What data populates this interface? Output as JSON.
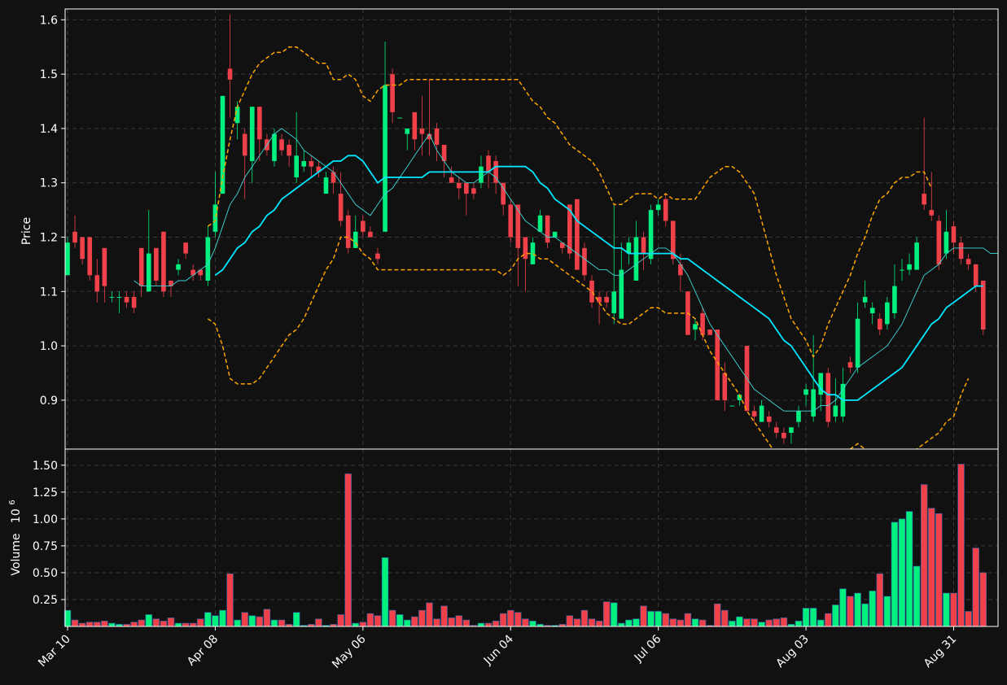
{
  "colors": {
    "background": "#111111",
    "up": "#00f080",
    "down": "#f0404a",
    "grid": "#3a3a3a",
    "axis": "#ffffff",
    "ma_fast": "#40d8d8",
    "ma_slow": "#00e8ff",
    "bollinger": "#ffa500"
  },
  "chart_data": {
    "type": "candlestick",
    "grid": true,
    "price_panel": {
      "ylabel": "Price",
      "ylim": [
        0.81,
        1.62
      ],
      "yticks": [
        "0.9",
        "1.0",
        "1.1",
        "1.2",
        "1.3",
        "1.4",
        "1.5",
        "1.6"
      ]
    },
    "volume_panel": {
      "ylabel": "Volume",
      "exponent_label": "10",
      "exponent_power": "6",
      "ylim": [
        0,
        1.65
      ],
      "yticks": [
        "0.25",
        "0.50",
        "0.75",
        "1.00",
        "1.25",
        "1.50"
      ]
    },
    "x_axis": {
      "index_range": [
        0,
        126
      ],
      "ticks": [
        {
          "label": "Mar 10",
          "index": 0
        },
        {
          "label": "Apr 08",
          "index": 20
        },
        {
          "label": "May 06",
          "index": 40
        },
        {
          "label": "Jun 04",
          "index": 60
        },
        {
          "label": "Jul 06",
          "index": 80
        },
        {
          "label": "Aug 03",
          "index": 100
        },
        {
          "label": "Aug 31",
          "index": 120
        }
      ]
    },
    "candles": [
      [
        1.13,
        1.19,
        1.2,
        1.13,
        0.15
      ],
      [
        1.21,
        1.19,
        1.24,
        1.18,
        0.06
      ],
      [
        1.2,
        1.16,
        1.2,
        1.15,
        0.03
      ],
      [
        1.2,
        1.13,
        1.2,
        1.12,
        0.04
      ],
      [
        1.13,
        1.1,
        1.16,
        1.08,
        0.04
      ],
      [
        1.18,
        1.11,
        1.18,
        1.08,
        0.05
      ],
      [
        1.09,
        1.09,
        1.1,
        1.08,
        0.03
      ],
      [
        1.09,
        1.09,
        1.1,
        1.06,
        0.02
      ],
      [
        1.09,
        1.08,
        1.1,
        1.07,
        0.02
      ],
      [
        1.09,
        1.07,
        1.1,
        1.06,
        0.04
      ],
      [
        1.18,
        1.11,
        1.18,
        1.09,
        0.06
      ],
      [
        1.1,
        1.17,
        1.25,
        1.1,
        0.11
      ],
      [
        1.18,
        1.12,
        1.18,
        1.11,
        0.07
      ],
      [
        1.21,
        1.1,
        1.21,
        1.09,
        0.05
      ],
      [
        1.12,
        1.11,
        1.12,
        1.09,
        0.08
      ],
      [
        1.14,
        1.15,
        1.16,
        1.13,
        0.03
      ],
      [
        1.19,
        1.17,
        1.19,
        1.16,
        0.03
      ],
      [
        1.14,
        1.13,
        1.15,
        1.12,
        0.03
      ],
      [
        1.14,
        1.13,
        1.14,
        1.12,
        0.07
      ],
      [
        1.12,
        1.2,
        1.22,
        1.11,
        0.13
      ],
      [
        1.21,
        1.26,
        1.32,
        1.2,
        0.1
      ],
      [
        1.28,
        1.46,
        1.46,
        1.28,
        0.15
      ],
      [
        1.51,
        1.49,
        1.61,
        1.42,
        0.49
      ],
      [
        1.41,
        1.44,
        1.45,
        1.38,
        0.06
      ],
      [
        1.39,
        1.35,
        1.4,
        1.27,
        0.13
      ],
      [
        1.34,
        1.44,
        1.44,
        1.3,
        0.1
      ],
      [
        1.44,
        1.38,
        1.44,
        1.34,
        0.09
      ],
      [
        1.38,
        1.36,
        1.39,
        1.35,
        0.16
      ],
      [
        1.34,
        1.39,
        1.4,
        1.33,
        0.06
      ],
      [
        1.38,
        1.36,
        1.39,
        1.35,
        0.06
      ],
      [
        1.37,
        1.35,
        1.38,
        1.33,
        0.02
      ],
      [
        1.31,
        1.35,
        1.43,
        1.3,
        0.13
      ],
      [
        1.33,
        1.34,
        1.36,
        1.32,
        0.01
      ],
      [
        1.34,
        1.33,
        1.35,
        1.31,
        0.02
      ],
      [
        1.33,
        1.32,
        1.34,
        1.31,
        0.07
      ],
      [
        1.28,
        1.31,
        1.32,
        1.28,
        0.01
      ],
      [
        1.32,
        1.3,
        1.33,
        1.28,
        0.02
      ],
      [
        1.28,
        1.23,
        1.32,
        1.22,
        0.11
      ],
      [
        1.24,
        1.18,
        1.25,
        1.17,
        1.42
      ],
      [
        1.18,
        1.21,
        1.24,
        1.18,
        0.03
      ],
      [
        1.23,
        1.21,
        1.24,
        1.2,
        0.04
      ],
      [
        1.21,
        1.2,
        1.22,
        1.2,
        0.12
      ],
      [
        1.17,
        1.16,
        1.18,
        1.15,
        0.1
      ],
      [
        1.21,
        1.48,
        1.56,
        1.21,
        0.64
      ],
      [
        1.5,
        1.43,
        1.51,
        1.41,
        0.15
      ],
      [
        1.42,
        1.42,
        1.42,
        1.42,
        0.11
      ],
      [
        1.39,
        1.4,
        1.4,
        1.36,
        0.06
      ],
      [
        1.43,
        1.38,
        1.43,
        1.36,
        0.09
      ],
      [
        1.4,
        1.39,
        1.46,
        1.35,
        0.15
      ],
      [
        1.39,
        1.38,
        1.49,
        1.35,
        0.22
      ],
      [
        1.4,
        1.37,
        1.41,
        1.34,
        0.07
      ],
      [
        1.37,
        1.34,
        1.37,
        1.31,
        0.19
      ],
      [
        1.31,
        1.3,
        1.33,
        1.3,
        0.08
      ],
      [
        1.3,
        1.29,
        1.31,
        1.27,
        0.1
      ],
      [
        1.3,
        1.28,
        1.3,
        1.24,
        0.06
      ],
      [
        1.29,
        1.28,
        1.3,
        1.27,
        0.01
      ],
      [
        1.3,
        1.33,
        1.35,
        1.29,
        0.03
      ],
      [
        1.35,
        1.32,
        1.36,
        1.29,
        0.03
      ],
      [
        1.34,
        1.3,
        1.35,
        1.28,
        0.05
      ],
      [
        1.3,
        1.26,
        1.3,
        1.24,
        0.12
      ],
      [
        1.26,
        1.2,
        1.27,
        1.19,
        0.15
      ],
      [
        1.26,
        1.18,
        1.26,
        1.11,
        0.13
      ],
      [
        1.2,
        1.16,
        1.2,
        1.1,
        0.07
      ],
      [
        1.15,
        1.19,
        1.2,
        1.15,
        0.05
      ],
      [
        1.21,
        1.24,
        1.25,
        1.21,
        0.02
      ],
      [
        1.24,
        1.19,
        1.24,
        1.18,
        0.01
      ],
      [
        1.2,
        1.21,
        1.21,
        1.2,
        0.01
      ],
      [
        1.19,
        1.18,
        1.19,
        1.17,
        0.02
      ],
      [
        1.26,
        1.17,
        1.26,
        1.16,
        0.1
      ],
      [
        1.27,
        1.14,
        1.27,
        1.14,
        0.07
      ],
      [
        1.18,
        1.13,
        1.19,
        1.12,
        0.15
      ],
      [
        1.12,
        1.08,
        1.13,
        1.07,
        0.07
      ],
      [
        1.09,
        1.08,
        1.1,
        1.04,
        0.05
      ],
      [
        1.09,
        1.08,
        1.1,
        1.07,
        0.23
      ],
      [
        1.06,
        1.1,
        1.26,
        1.04,
        0.22
      ],
      [
        1.05,
        1.14,
        1.19,
        1.05,
        0.03
      ],
      [
        1.17,
        1.19,
        1.2,
        1.15,
        0.06
      ],
      [
        1.12,
        1.2,
        1.23,
        1.12,
        0.07
      ],
      [
        1.2,
        1.17,
        1.21,
        1.14,
        0.19
      ],
      [
        1.16,
        1.25,
        1.26,
        1.15,
        0.14
      ],
      [
        1.25,
        1.26,
        1.27,
        1.24,
        0.14
      ],
      [
        1.27,
        1.23,
        1.28,
        1.22,
        0.12
      ],
      [
        1.23,
        1.16,
        1.23,
        1.15,
        0.07
      ],
      [
        1.15,
        1.13,
        1.17,
        1.1,
        0.06
      ],
      [
        1.1,
        1.02,
        1.1,
        1.02,
        0.12
      ],
      [
        1.03,
        1.04,
        1.05,
        1.01,
        0.07
      ],
      [
        1.06,
        1.02,
        1.07,
        1.01,
        0.06
      ],
      [
        1.03,
        1.02,
        1.03,
        1.02,
        0.01
      ],
      [
        1.03,
        0.9,
        1.03,
        0.9,
        0.21
      ],
      [
        0.95,
        0.9,
        0.97,
        0.88,
        0.15
      ],
      [
        0.89,
        0.89,
        0.89,
        0.89,
        0.05
      ],
      [
        0.9,
        0.91,
        0.91,
        0.89,
        0.09
      ],
      [
        1.0,
        0.88,
        1.0,
        0.88,
        0.07
      ],
      [
        0.88,
        0.87,
        0.89,
        0.86,
        0.07
      ],
      [
        0.86,
        0.89,
        0.9,
        0.86,
        0.04
      ],
      [
        0.87,
        0.86,
        0.88,
        0.85,
        0.06
      ],
      [
        0.85,
        0.84,
        0.86,
        0.83,
        0.07
      ],
      [
        0.84,
        0.83,
        0.85,
        0.82,
        0.08
      ],
      [
        0.84,
        0.85,
        0.85,
        0.82,
        0.02
      ],
      [
        0.86,
        0.88,
        0.89,
        0.85,
        0.05
      ],
      [
        0.91,
        0.92,
        0.93,
        0.89,
        0.17
      ],
      [
        0.87,
        0.92,
        1.02,
        0.86,
        0.17
      ],
      [
        0.91,
        0.95,
        0.95,
        0.88,
        0.06
      ],
      [
        0.95,
        0.86,
        0.96,
        0.85,
        0.12
      ],
      [
        0.87,
        0.89,
        0.94,
        0.86,
        0.2
      ],
      [
        0.87,
        0.93,
        0.96,
        0.86,
        0.35
      ],
      [
        0.97,
        0.96,
        0.98,
        0.95,
        0.28
      ],
      [
        0.96,
        1.05,
        1.08,
        0.95,
        0.31
      ],
      [
        1.08,
        1.09,
        1.12,
        1.07,
        0.21
      ],
      [
        1.06,
        1.07,
        1.08,
        1.04,
        0.33
      ],
      [
        1.05,
        1.03,
        1.06,
        1.02,
        0.49
      ],
      [
        1.04,
        1.08,
        1.09,
        1.03,
        0.28
      ],
      [
        1.06,
        1.11,
        1.15,
        1.05,
        0.97
      ],
      [
        1.14,
        1.14,
        1.16,
        1.12,
        1.0
      ],
      [
        1.14,
        1.15,
        1.17,
        1.13,
        1.07
      ],
      [
        1.14,
        1.19,
        1.2,
        1.14,
        0.56
      ],
      [
        1.28,
        1.26,
        1.42,
        1.25,
        1.32
      ],
      [
        1.25,
        1.24,
        1.32,
        1.23,
        1.1
      ],
      [
        1.23,
        1.15,
        1.24,
        1.14,
        1.05
      ],
      [
        1.17,
        1.21,
        1.25,
        1.16,
        0.31
      ],
      [
        1.22,
        1.19,
        1.23,
        1.17,
        0.31
      ],
      [
        1.19,
        1.16,
        1.2,
        1.15,
        1.51
      ],
      [
        1.16,
        1.15,
        1.17,
        1.14,
        0.14
      ],
      [
        1.15,
        1.11,
        1.15,
        1.1,
        0.73
      ],
      [
        1.12,
        1.03,
        1.12,
        1.02,
        0.5
      ]
    ],
    "ma_fast": [
      null,
      null,
      null,
      null,
      null,
      null,
      null,
      null,
      null,
      1.12,
      1.11,
      1.11,
      1.11,
      1.11,
      1.11,
      1.12,
      1.12,
      1.13,
      1.14,
      1.15,
      1.18,
      1.22,
      1.26,
      1.28,
      1.31,
      1.33,
      1.35,
      1.37,
      1.39,
      1.4,
      1.39,
      1.38,
      1.36,
      1.35,
      1.34,
      1.33,
      1.32,
      1.3,
      1.28,
      1.26,
      1.25,
      1.24,
      1.26,
      1.28,
      1.29,
      1.31,
      1.33,
      1.35,
      1.37,
      1.39,
      1.36,
      1.34,
      1.32,
      1.31,
      1.3,
      1.3,
      1.31,
      1.32,
      1.31,
      1.29,
      1.27,
      1.25,
      1.23,
      1.22,
      1.21,
      1.2,
      1.2,
      1.19,
      1.18,
      1.17,
      1.16,
      1.15,
      1.14,
      1.14,
      1.13,
      1.13,
      1.14,
      1.15,
      1.16,
      1.17,
      1.18,
      1.18,
      1.17,
      1.15,
      1.13,
      1.1,
      1.07,
      1.04,
      1.02,
      1.0,
      0.98,
      0.96,
      0.94,
      0.92,
      0.91,
      0.9,
      0.89,
      0.88,
      0.88,
      0.88,
      0.88,
      0.88,
      0.89,
      0.89,
      0.9,
      0.92,
      0.94,
      0.96,
      0.97,
      0.98,
      0.99,
      1.0,
      1.02,
      1.04,
      1.07,
      1.1,
      1.13,
      1.14,
      1.15,
      1.17,
      1.18,
      1.18,
      1.18,
      1.18,
      1.18,
      1.17,
      1.17
    ],
    "ma_slow": [
      null,
      null,
      null,
      null,
      null,
      null,
      null,
      null,
      null,
      null,
      null,
      null,
      null,
      null,
      null,
      null,
      null,
      null,
      null,
      null,
      1.13,
      1.14,
      1.16,
      1.18,
      1.19,
      1.21,
      1.22,
      1.24,
      1.25,
      1.27,
      1.28,
      1.29,
      1.3,
      1.31,
      1.32,
      1.33,
      1.34,
      1.34,
      1.35,
      1.35,
      1.34,
      1.32,
      1.3,
      1.31,
      1.31,
      1.31,
      1.31,
      1.31,
      1.31,
      1.32,
      1.32,
      1.32,
      1.32,
      1.32,
      1.32,
      1.32,
      1.32,
      1.32,
      1.33,
      1.33,
      1.33,
      1.33,
      1.33,
      1.32,
      1.3,
      1.29,
      1.27,
      1.26,
      1.25,
      1.23,
      1.22,
      1.21,
      1.2,
      1.19,
      1.18,
      1.18,
      1.17,
      1.17,
      1.17,
      1.17,
      1.17,
      1.17,
      1.17,
      1.16,
      1.16,
      1.15,
      1.14,
      1.13,
      1.12,
      1.11,
      1.1,
      1.09,
      1.08,
      1.07,
      1.06,
      1.05,
      1.03,
      1.01,
      1.0,
      0.98,
      0.96,
      0.94,
      0.92,
      0.91,
      0.91,
      0.9,
      0.9,
      0.9,
      0.91,
      0.92,
      0.93,
      0.94,
      0.95,
      0.96,
      0.98,
      1.0,
      1.02,
      1.04,
      1.05,
      1.07,
      1.08,
      1.09,
      1.1,
      1.11,
      1.11
    ],
    "boll_upper": [
      null,
      null,
      null,
      null,
      null,
      null,
      null,
      null,
      null,
      null,
      null,
      null,
      null,
      null,
      null,
      null,
      null,
      null,
      null,
      1.22,
      1.23,
      1.31,
      1.38,
      1.44,
      1.47,
      1.5,
      1.52,
      1.53,
      1.54,
      1.54,
      1.55,
      1.55,
      1.54,
      1.53,
      1.52,
      1.52,
      1.49,
      1.49,
      1.5,
      1.49,
      1.46,
      1.45,
      1.47,
      1.48,
      1.48,
      1.48,
      1.49,
      1.49,
      1.49,
      1.49,
      1.49,
      1.49,
      1.49,
      1.49,
      1.49,
      1.49,
      1.49,
      1.49,
      1.49,
      1.49,
      1.49,
      1.49,
      1.47,
      1.45,
      1.44,
      1.42,
      1.41,
      1.39,
      1.37,
      1.36,
      1.35,
      1.34,
      1.32,
      1.29,
      1.26,
      1.26,
      1.27,
      1.28,
      1.28,
      1.28,
      1.27,
      1.28,
      1.27,
      1.27,
      1.27,
      1.27,
      1.29,
      1.31,
      1.32,
      1.33,
      1.33,
      1.32,
      1.3,
      1.28,
      1.23,
      1.18,
      1.13,
      1.09,
      1.05,
      1.03,
      1.01,
      0.98,
      1.0,
      1.04,
      1.07,
      1.1,
      1.13,
      1.17,
      1.2,
      1.24,
      1.27,
      1.28,
      1.3,
      1.31,
      1.31,
      1.32,
      1.32,
      1.29
    ],
    "boll_lower": [
      null,
      null,
      null,
      null,
      null,
      null,
      null,
      null,
      null,
      null,
      null,
      null,
      null,
      null,
      null,
      null,
      null,
      null,
      null,
      1.05,
      1.04,
      1.0,
      0.94,
      0.93,
      0.93,
      0.93,
      0.94,
      0.96,
      0.98,
      1.0,
      1.02,
      1.03,
      1.05,
      1.08,
      1.11,
      1.14,
      1.16,
      1.2,
      1.2,
      1.19,
      1.17,
      1.16,
      1.14,
      1.14,
      1.14,
      1.14,
      1.14,
      1.14,
      1.14,
      1.14,
      1.14,
      1.14,
      1.14,
      1.14,
      1.14,
      1.14,
      1.14,
      1.14,
      1.14,
      1.13,
      1.14,
      1.16,
      1.17,
      1.17,
      1.16,
      1.16,
      1.15,
      1.14,
      1.13,
      1.12,
      1.11,
      1.1,
      1.08,
      1.06,
      1.05,
      1.04,
      1.04,
      1.05,
      1.06,
      1.07,
      1.07,
      1.06,
      1.06,
      1.06,
      1.06,
      1.05,
      1.02,
      0.99,
      0.97,
      0.95,
      0.93,
      0.91,
      0.88,
      0.86,
      0.84,
      0.82,
      0.8,
      0.78,
      0.77,
      0.76,
      0.76,
      0.76,
      0.77,
      0.78,
      0.79,
      0.8,
      0.81,
      0.82,
      0.81,
      0.8,
      0.79,
      0.78,
      0.78,
      0.79,
      0.8,
      0.81,
      0.82,
      0.83,
      0.84,
      0.86,
      0.87,
      0.91,
      0.94
    ]
  }
}
